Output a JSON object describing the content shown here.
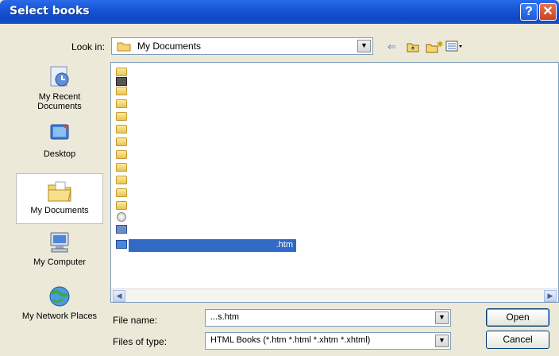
{
  "window": {
    "title": "Select books",
    "help_glyph": "?",
    "close_glyph": "✕"
  },
  "lookin": {
    "label": "Look in:",
    "value": "My Documents",
    "arrow": "▼",
    "back": "⇐",
    "up": "🗀",
    "new_folder": "✱",
    "views": "▦▾"
  },
  "places": [
    {
      "name": "recent",
      "label": "My Recent Documents",
      "icon": "recent-documents-icon"
    },
    {
      "name": "desktop",
      "label": "Desktop",
      "icon": "desktop-icon"
    },
    {
      "name": "my-documents",
      "label": "My Documents",
      "icon": "my-documents-icon",
      "active": true
    },
    {
      "name": "my-computer",
      "label": "My Computer",
      "icon": "my-computer-icon"
    },
    {
      "name": "network",
      "label": "My Network Places",
      "icon": "network-places-icon"
    }
  ],
  "files": {
    "selected_suffix": ".htm"
  },
  "fields": {
    "filename_label": "File name:",
    "filename_value": "...s.htm",
    "filetype_label": "Files of type:",
    "filetype_value": "HTML Books (*.htm *.html *.xhtm *.xhtml)",
    "arrow": "▼"
  },
  "buttons": {
    "open": "Open",
    "cancel": "Cancel"
  },
  "colors": {
    "titlebar": "#1756D6",
    "selection": "#316AC5",
    "dialog_bg": "#ECE9D8"
  }
}
